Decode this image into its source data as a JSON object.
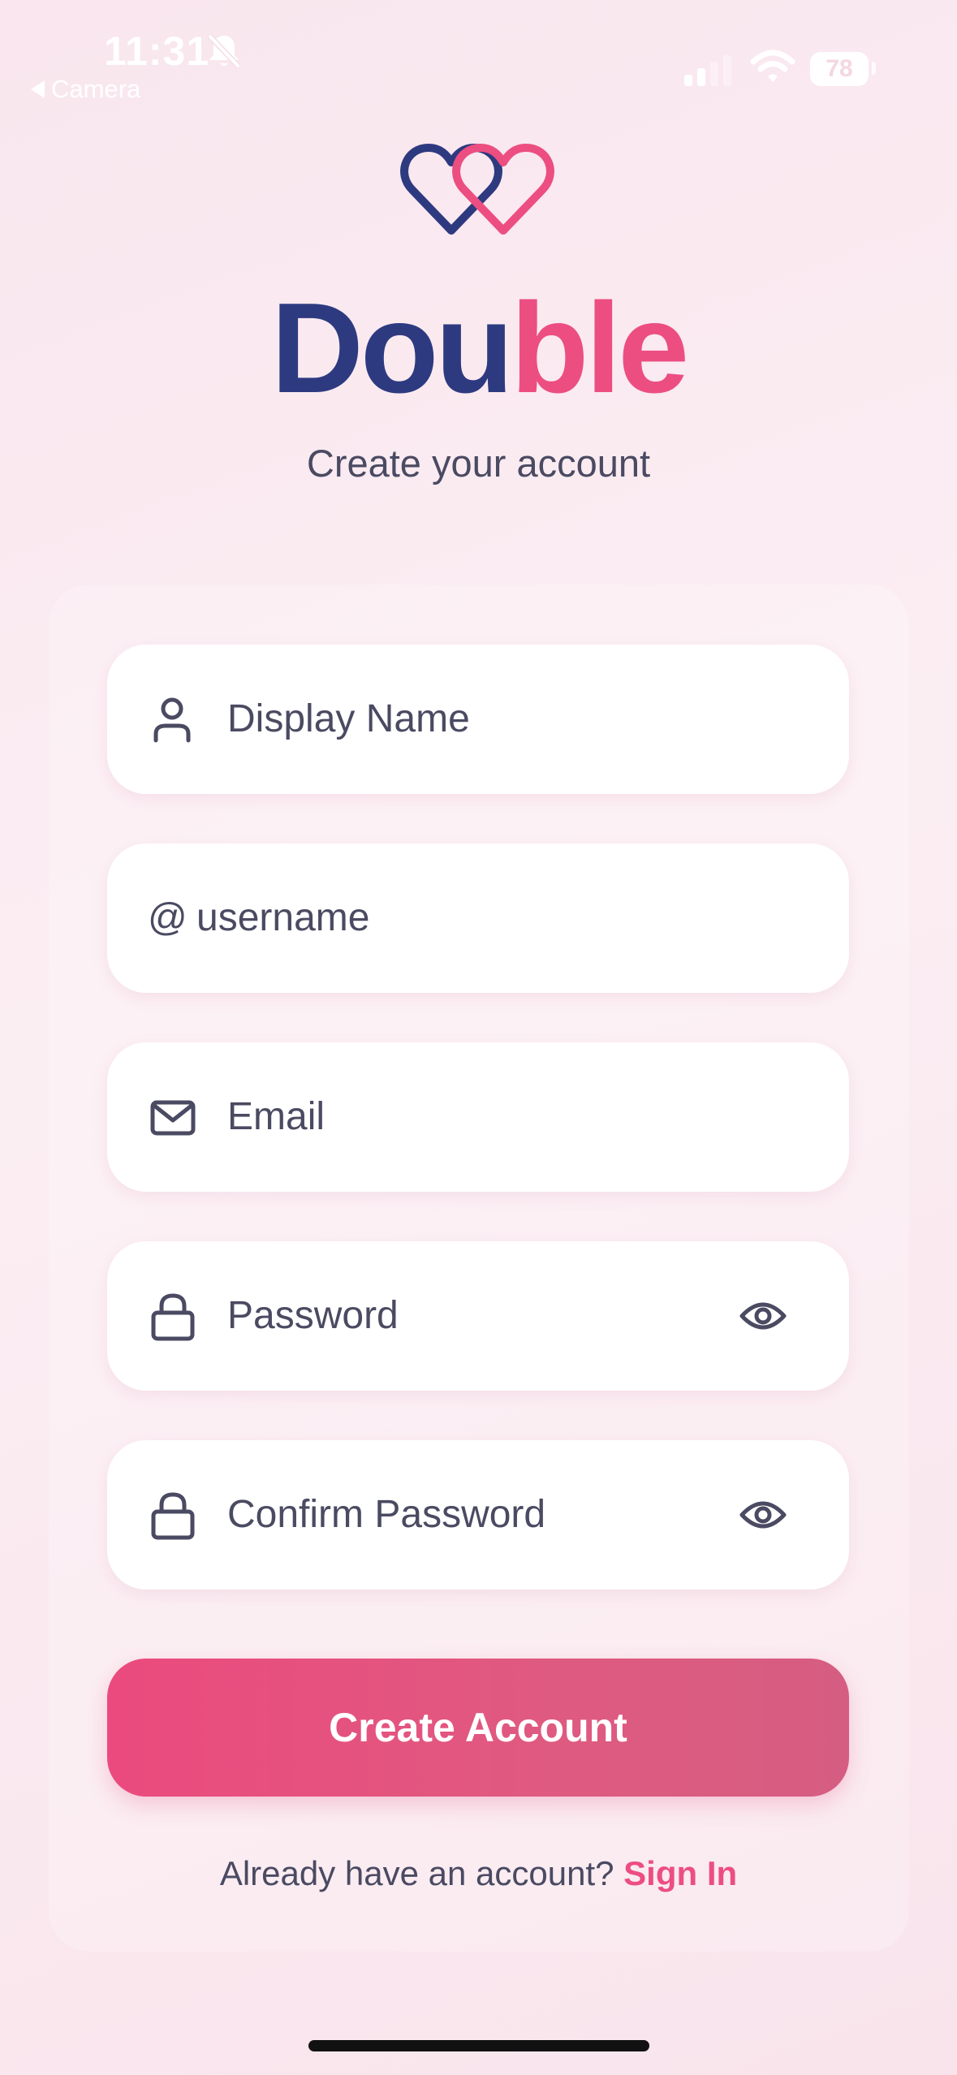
{
  "status_bar": {
    "time": "11:31",
    "back_app": "Camera",
    "battery": "78"
  },
  "brand": {
    "part1": "Dou",
    "part2": "ble",
    "subtitle": "Create your account",
    "colors": {
      "navy": "#2e3a80",
      "pink": "#ec4e82"
    }
  },
  "form": {
    "display_name": {
      "placeholder": "Display Name",
      "icon": "person-icon"
    },
    "username": {
      "prefix": "@",
      "placeholder": "username"
    },
    "email": {
      "placeholder": "Email",
      "icon": "mail-icon"
    },
    "password": {
      "placeholder": "Password",
      "icon": "lock-icon",
      "toggle_icon": "eye-icon"
    },
    "confirm_password": {
      "placeholder": "Confirm Password",
      "icon": "lock-icon",
      "toggle_icon": "eye-icon"
    }
  },
  "actions": {
    "create_account": "Create Account",
    "signin_prompt": "Already have an account?",
    "signin_link": "Sign In"
  }
}
